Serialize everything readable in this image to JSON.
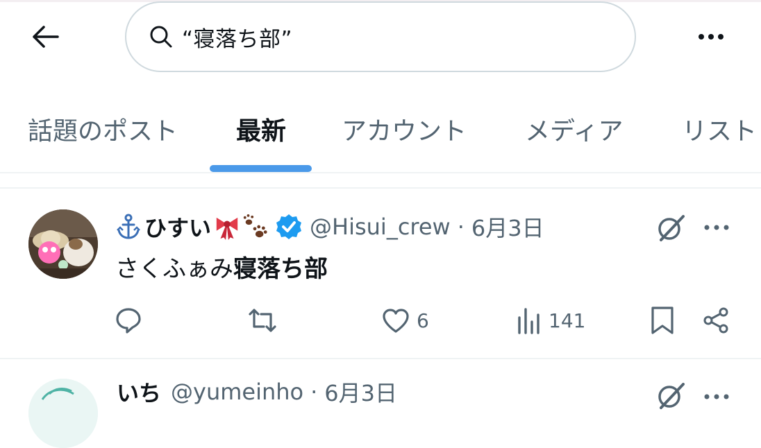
{
  "header": {
    "search_query": "“寝落ち部”"
  },
  "tabs": [
    {
      "label": "話題のポスト",
      "active": false
    },
    {
      "label": "最新",
      "active": true
    },
    {
      "label": "アカウント",
      "active": false
    },
    {
      "label": "メディア",
      "active": false
    },
    {
      "label": "リスト",
      "active": false
    }
  ],
  "post": {
    "display_name_prefix_emoji": "⚓",
    "display_name": "ひすい",
    "display_name_suffix_emojis": [
      "🎀",
      "🐾"
    ],
    "verified": true,
    "handle": "@Hisui_crew",
    "separator": "·",
    "date": "6月3日",
    "text_plain": "さくふぁみ",
    "text_highlight": "寝落ち部",
    "actions": {
      "reply_count": "",
      "repost_count": "",
      "like_count": "6",
      "views_count": "141"
    }
  },
  "next_post": {
    "display_name": "いち",
    "handle": "@yumeinho",
    "separator": "·",
    "date": "6月3日"
  },
  "colors": {
    "accent": "#4a99e9",
    "secondary_text": "#536471",
    "primary_text": "#0f1419",
    "verified_blue": "#1d9bf0"
  },
  "icons": [
    "back-arrow-icon",
    "search-icon",
    "more-icon",
    "verified-badge-icon",
    "grok-icon",
    "reply-icon",
    "repost-icon",
    "like-icon",
    "views-icon",
    "bookmark-icon",
    "share-icon"
  ]
}
